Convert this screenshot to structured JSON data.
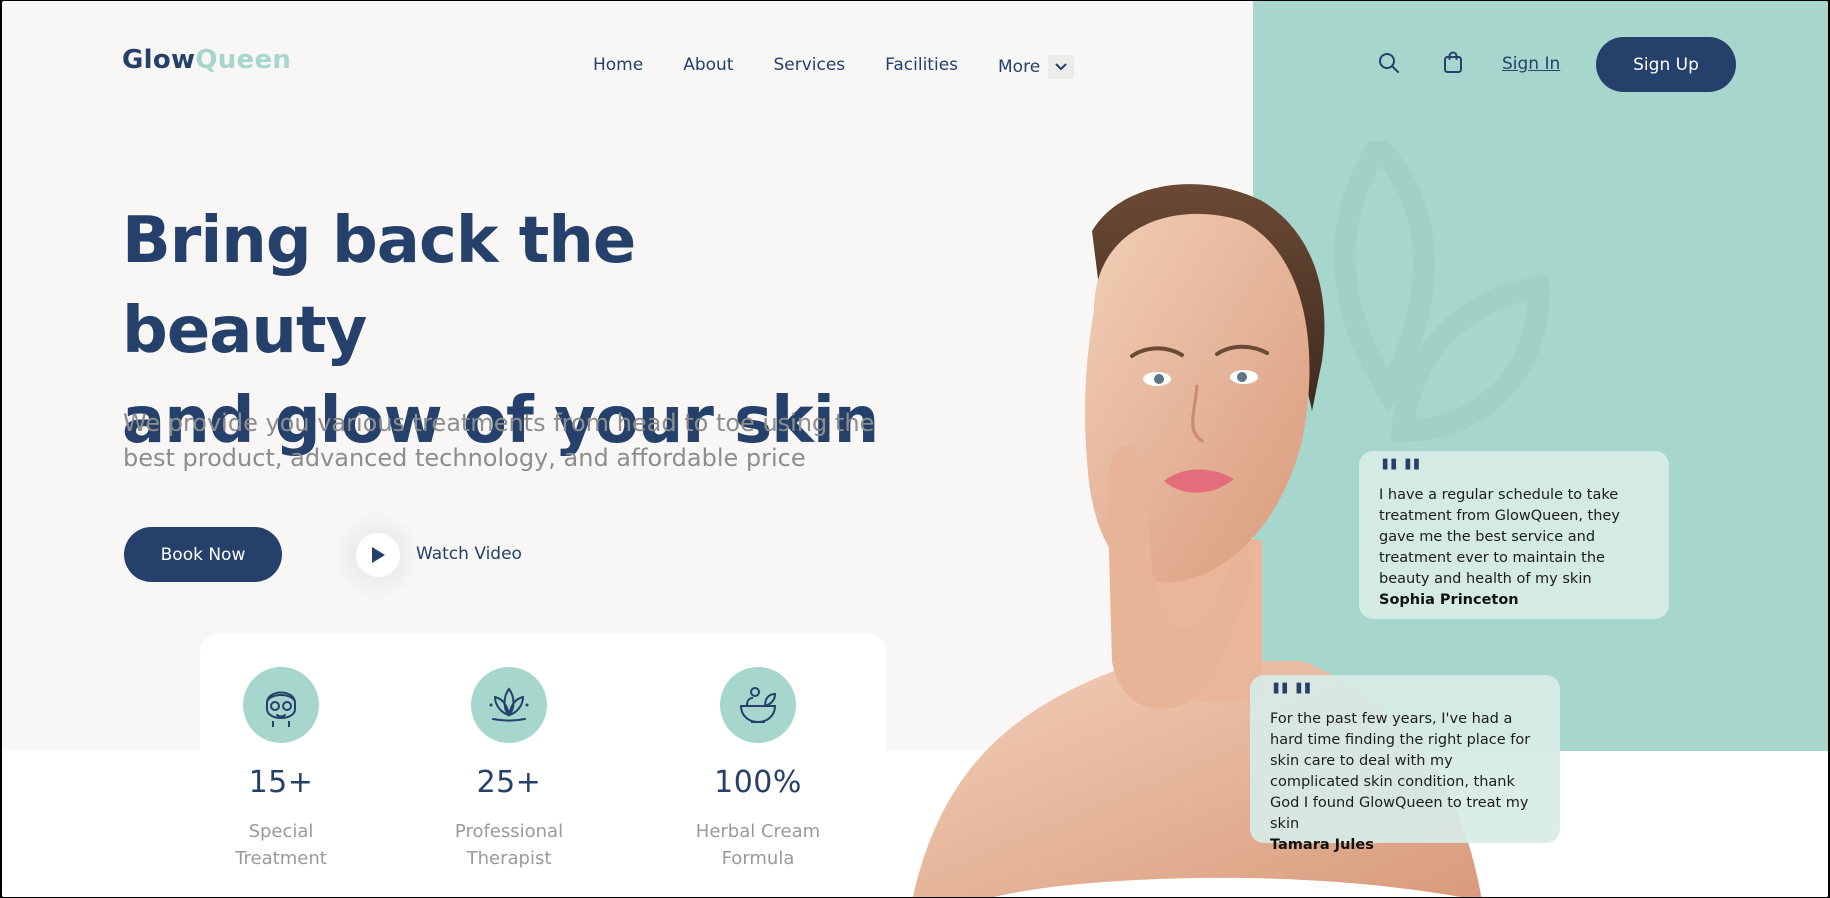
{
  "brand": {
    "part1": "Glow",
    "part2": "Queen"
  },
  "nav": {
    "items": [
      "Home",
      "About",
      "Services",
      "Facilities"
    ],
    "more_label": "More"
  },
  "header": {
    "search_icon": "search-icon",
    "cart_icon": "shopping-bag-icon",
    "sign_in": "Sign In",
    "sign_up": "Sign Up"
  },
  "hero": {
    "title_line1": "Bring back the beauty",
    "title_line2": "and glow of your skin",
    "subtitle_line1": "We provide you various treatments from head to toe using the",
    "subtitle_line2": "best product, advanced technology, and affordable price",
    "book_label": "Book Now",
    "watch_label": "Watch Video"
  },
  "stats": [
    {
      "icon": "face-mask-icon",
      "value": "15+",
      "label_line1": "Special",
      "label_line2": "Treatment"
    },
    {
      "icon": "lotus-icon",
      "value": "25+",
      "label_line1": "Professional",
      "label_line2": "Therapist"
    },
    {
      "icon": "herbal-bowl-icon",
      "value": "100%",
      "label_line1": "Herbal Cream",
      "label_line2": "Formula"
    }
  ],
  "testimonials": [
    {
      "text": "I have a regular schedule to take treatment from GlowQueen, they gave me the best service and treatment ever to maintain the beauty and health of my skin",
      "name": "Sophia Princeton"
    },
    {
      "text": "For the past few years, I've had a hard time finding the right place for skin care to deal with my complicated skin condition, thank God I found GlowQueen to treat my skin",
      "name": "Tamara Jules"
    }
  ],
  "colors": {
    "navy": "#24406b",
    "mint": "#a7d6cc",
    "background": "#f8f7f5",
    "muted_text": "#8d8d8d"
  }
}
